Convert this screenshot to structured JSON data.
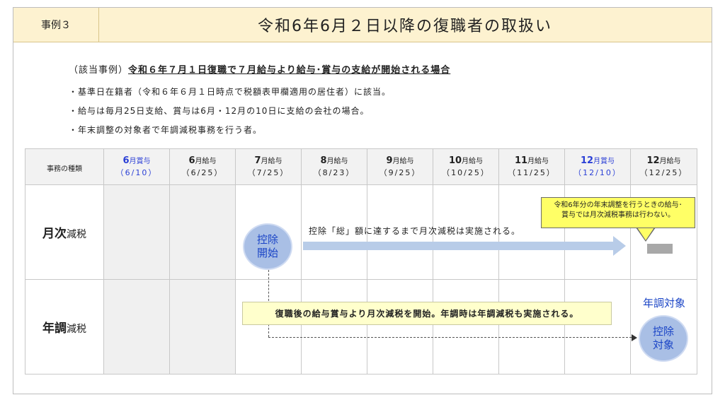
{
  "header": {
    "case_tag": "事例３",
    "title": "令和6年6月２日以降の復職者の取扱い"
  },
  "case": {
    "prefix": "（該当事例）",
    "title": "令和６年７月１日復職で７月給与より給与･賞与の支給が開始される場合"
  },
  "bullets": [
    "・基準日在籍者（令和６年６月１日時点で税額表甲欄適用の居住者）に該当。",
    "・給与は毎月25日支給、賞与は6月・12月の10日に支給の会社の場合。",
    "・年末調整の対象者で年調減税事務を行う者。"
  ],
  "table": {
    "kind_header": "事務の種類",
    "columns": [
      {
        "num": "6",
        "unit": "月賞与",
        "date": "（6/10）",
        "highlight": true
      },
      {
        "num": "6",
        "unit": "月給与",
        "date": "（6/25）",
        "highlight": false
      },
      {
        "num": "7",
        "unit": "月給与",
        "date": "（7/25）",
        "highlight": false
      },
      {
        "num": "8",
        "unit": "月給与",
        "date": "（8/23）",
        "highlight": false
      },
      {
        "num": "9",
        "unit": "月給与",
        "date": "（9/25）",
        "highlight": false
      },
      {
        "num": "10",
        "unit": "月給与",
        "date": "（10/25）",
        "highlight": false
      },
      {
        "num": "11",
        "unit": "月給与",
        "date": "（11/25）",
        "highlight": false
      },
      {
        "num": "12",
        "unit": "月賞与",
        "date": "（12/10）",
        "highlight": true
      },
      {
        "num": "12",
        "unit": "月給与",
        "date": "（12/25）",
        "highlight": false
      }
    ],
    "rows": [
      {
        "bold": "月次",
        "rest": "減税"
      },
      {
        "bold": "年調",
        "rest": "減税"
      }
    ]
  },
  "annotations": {
    "start_circle_line1": "控除",
    "start_circle_line2": "開始",
    "deduct_note": "控除「総」額に達するまで月次減税は実施される。",
    "callout_line1": "令和6年分の年末調整を行うときの給与･",
    "callout_line2": "賞与では月次減税事務は行わない。",
    "yearly_note": "復職後の給与賞与より月次減税を開始。年調時は年調減税も実施される。",
    "target_label": "年調対象",
    "target_circle_line1": "控除",
    "target_circle_line2": "対象"
  },
  "colors": {
    "header_bg": "#fdf2d0",
    "highlight_blue": "#2a3fd6",
    "circle_fill": "#a9bfe5",
    "callout_yellow": "#ffff66"
  }
}
